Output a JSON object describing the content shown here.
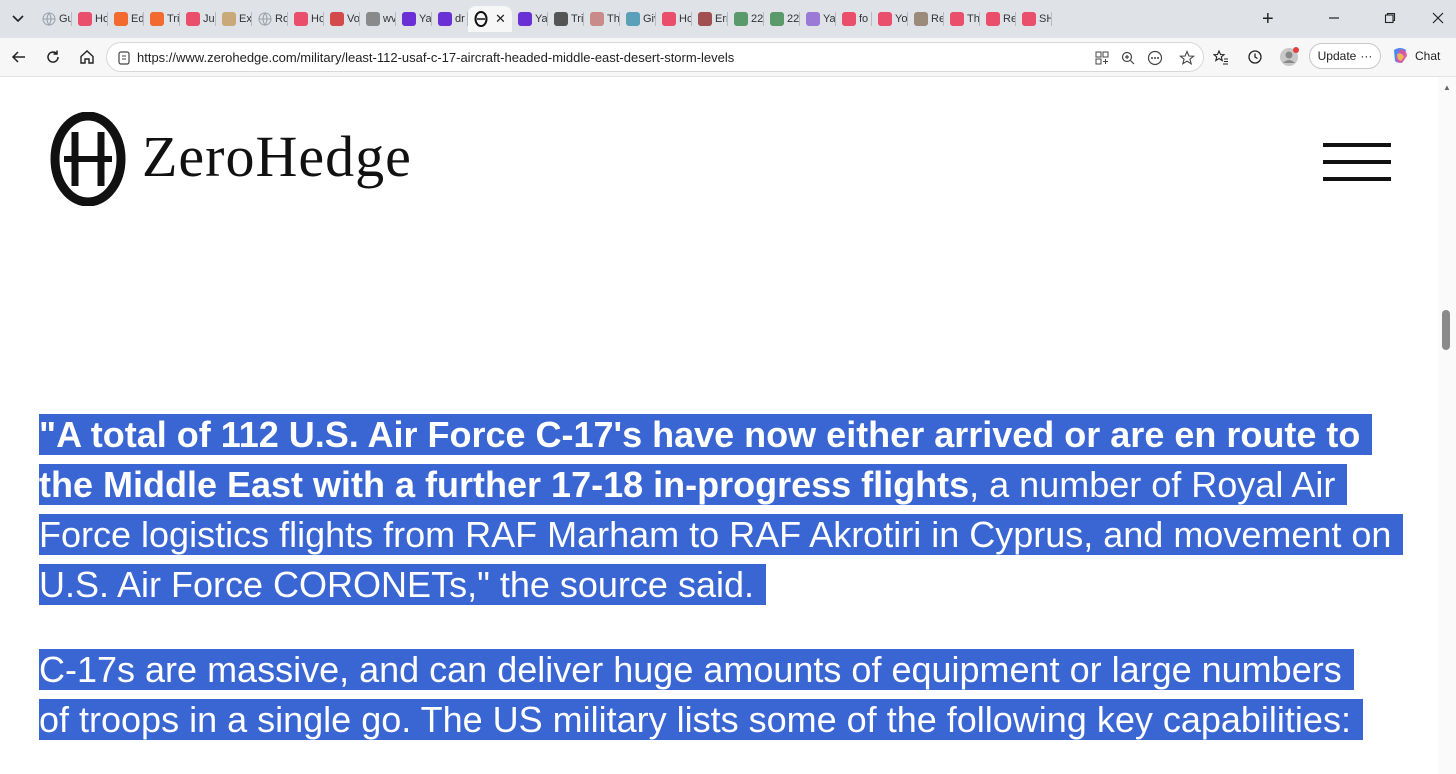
{
  "browser": {
    "tabs": [
      {
        "label": "Gu",
        "icon": "globe-icon",
        "color": "#9aa0a6"
      },
      {
        "label": "Ho",
        "icon": "youtube-icon",
        "color": "#e94e6a"
      },
      {
        "label": "Ed",
        "icon": "substack-icon",
        "color": "#f26a2e"
      },
      {
        "label": "Tri",
        "icon": "substack-icon",
        "color": "#f26a2e"
      },
      {
        "label": "Jus",
        "icon": "youtube-icon",
        "color": "#e94e6a"
      },
      {
        "label": "Ex",
        "icon": "seal-icon",
        "color": "#c9a97a"
      },
      {
        "label": "Ro",
        "icon": "globe-icon",
        "color": "#9aa0a6"
      },
      {
        "label": "Ho",
        "icon": "youtube-icon",
        "color": "#e94e6a"
      },
      {
        "label": "Vo",
        "icon": "news-icon",
        "color": "#d24a4a"
      },
      {
        "label": "wv",
        "icon": "doc-icon",
        "color": "#8a8a8a"
      },
      {
        "label": "Ya",
        "icon": "yahoo-icon",
        "color": "#6b2fd6"
      },
      {
        "label": "dr",
        "icon": "yahoo-icon",
        "color": "#6b2fd6"
      },
      {
        "label": "",
        "icon": "zerohedge-icon",
        "color": "#111111",
        "active": true
      },
      {
        "label": "Ya",
        "icon": "yahoo-icon",
        "color": "#6b2fd6"
      },
      {
        "label": "Tri",
        "icon": "x-icon",
        "color": "#555555"
      },
      {
        "label": "Th",
        "icon": "plane-icon",
        "color": "#c98a8a"
      },
      {
        "label": "Giv",
        "icon": "snowflake-icon",
        "color": "#5aa0b8"
      },
      {
        "label": "Ho",
        "icon": "youtube-icon",
        "color": "#e94e6a"
      },
      {
        "label": "Err",
        "icon": "flag-icon",
        "color": "#a05050"
      },
      {
        "label": "22",
        "icon": "sheet-icon",
        "color": "#5a9a6a"
      },
      {
        "label": "22",
        "icon": "sheet-icon",
        "color": "#5a9a6a"
      },
      {
        "label": "Ya",
        "icon": "yahoo-icon",
        "color": "#9a7ad6"
      },
      {
        "label": "fo",
        "icon": "youtube-icon",
        "color": "#e94e6a"
      },
      {
        "label": "Yo",
        "icon": "youtube-icon",
        "color": "#e94e6a"
      },
      {
        "label": "Re",
        "icon": "reddit-icon",
        "color": "#9a8a7a"
      },
      {
        "label": "Th",
        "icon": "youtube-icon",
        "color": "#e94e6a"
      },
      {
        "label": "Re",
        "icon": "youtube-icon",
        "color": "#e94e6a"
      },
      {
        "label": "SH",
        "icon": "youtube-icon",
        "color": "#e94e6a"
      }
    ],
    "url": "https://www.zerohedge.com/military/least-112-usaf-c-17-aircraft-headed-middle-east-desert-storm-levels",
    "update_label": "Update",
    "update_more": "···",
    "chat_label": "Chat",
    "active_tab_close": "✕",
    "new_tab": "+"
  },
  "site": {
    "logo_text": "ZeroHedge"
  },
  "article": {
    "p1_bold": "\"A total of 112 U.S. Air Force C-17's have now either arrived or are en route to the Middle East with a further 17-18 in-progress flights",
    "p1_rest": ", a number of Royal Air Force logistics flights from RAF Marham to RAF Akrotiri in Cyprus, and movement on U.S. Air Force CORONETs,\" the source said.",
    "p2": "C-17s are massive, and can deliver huge amounts of equipment or large numbers of troops in a single go. The US military lists some of the following key capabilities:"
  },
  "colors": {
    "selection": "#3a66d4",
    "tabstrip": "#dfe3e8"
  }
}
